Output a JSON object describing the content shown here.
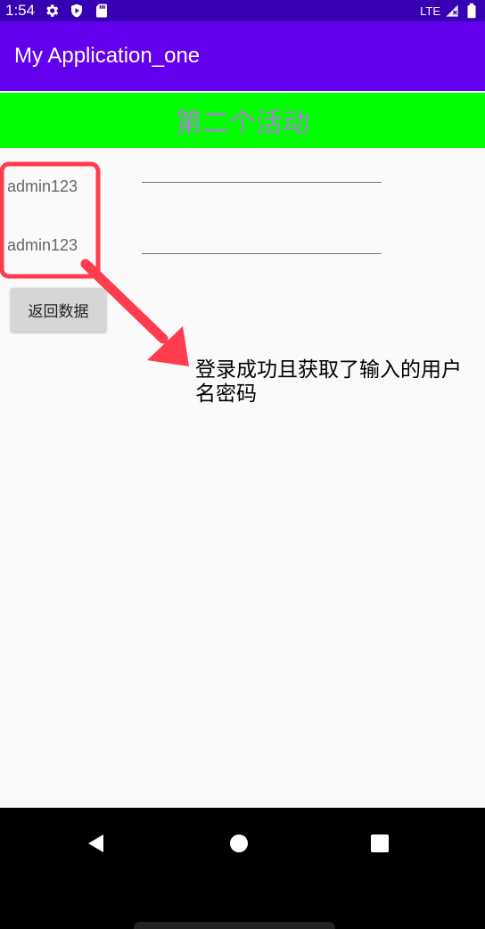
{
  "status_bar": {
    "time": "1:54",
    "network": "LTE"
  },
  "app_bar": {
    "title": "My Application_one"
  },
  "activity": {
    "banner_title": "第二个活动",
    "username_value": "admin123",
    "password_value": "admin123",
    "return_button_label": "返回数据"
  },
  "annotation": {
    "text": "登录成功且获取了输入的用户名密码"
  },
  "colors": {
    "status_bar": "#3700b3",
    "app_bar": "#6200ee",
    "banner_bg": "#00ff00",
    "banner_text": "#b57be0",
    "annotation_red": "#ff3b4e"
  }
}
